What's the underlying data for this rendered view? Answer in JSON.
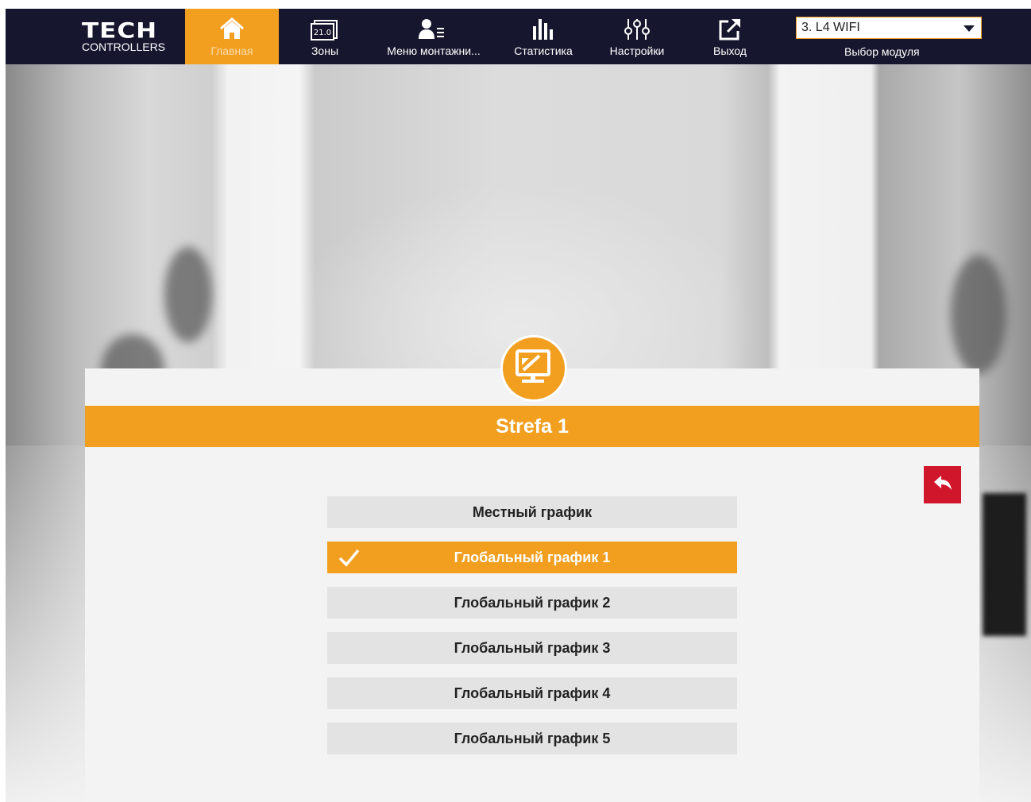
{
  "brand": {
    "line1": "TECH",
    "line2": "CONTROLLERS"
  },
  "nav": [
    {
      "label": "Главная",
      "icon": "home-icon",
      "active": true
    },
    {
      "label": "Зоны",
      "icon": "zones-icon",
      "badge": "21.0"
    },
    {
      "label": "Меню монтажни...",
      "icon": "installer-menu-icon"
    },
    {
      "label": "Статистика",
      "icon": "statistics-icon"
    },
    {
      "label": "Настройки",
      "icon": "settings-sliders-icon"
    },
    {
      "label": "Выход",
      "icon": "logout-icon"
    }
  ],
  "module_select": {
    "value": "3. L4 WIFI",
    "label": "Выбор модуля"
  },
  "panel": {
    "title": "Strefa 1",
    "icon": "monitor-icon",
    "back_icon": "back-arrow-icon",
    "options": [
      {
        "label": "Местный график",
        "selected": false
      },
      {
        "label": "Глобальный график 1",
        "selected": true
      },
      {
        "label": "Глобальный график 2",
        "selected": false
      },
      {
        "label": "Глобальный график 3",
        "selected": false
      },
      {
        "label": "Глобальный график 4",
        "selected": false
      },
      {
        "label": "Глобальный график 5",
        "selected": false
      }
    ]
  },
  "colors": {
    "accent": "#f29e1f",
    "topbar": "#16172e",
    "back_button": "#d0162a",
    "option_bg": "#e3e3e3"
  }
}
